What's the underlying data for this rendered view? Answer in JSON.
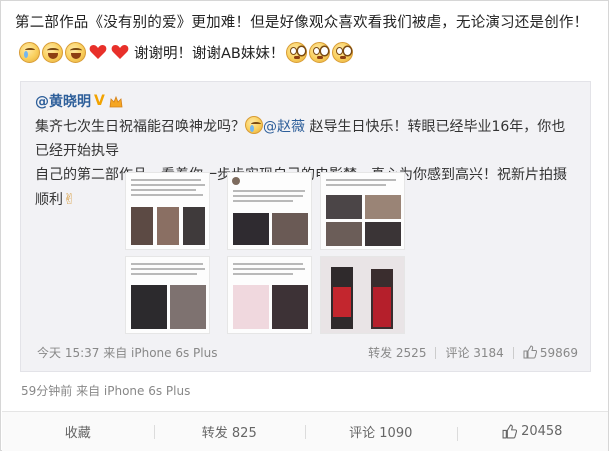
{
  "post": {
    "text_line1": "第二部作品《没有别的爱》更加难！但是好像观众喜欢看我们被虐，无论演习还是创作！",
    "text_line2": "谢谢明！谢谢AB妹妹！",
    "meta": "59分钟前 来自 iPhone 6s Plus",
    "emoji_left": [
      "tear-face",
      "laugh-face",
      "laugh-face",
      "red-heart",
      "red-heart"
    ],
    "emoji_right": [
      "wide-eyed-face",
      "wide-eyed-face",
      "wide-eyed-face"
    ]
  },
  "repost": {
    "author": "@黄晓明",
    "verified_badge": "V",
    "text_a": "集齐七次生日祝福能召唤神龙吗？",
    "mention": "@赵薇",
    "text_b": "赵导生日快乐！转眼已经毕业16年，你也已经开始执导",
    "text_c": "自己的第二部作品，看着你一步步实现自己的电影梦，真心为你感到高兴！祝新片拍摄顺利",
    "victory": "✌",
    "meta": "今天 15:37 来自 iPhone 6s Plus",
    "reposts": "转发 2525",
    "comments": "评论 3184",
    "likes": "59869"
  },
  "actions": {
    "favorite": "收藏",
    "repost": "转发 825",
    "comment": "评论 1090",
    "like": "20458"
  },
  "colors": {
    "link": "#2e5f9a",
    "badge": "#f2a300",
    "muted": "#888888"
  }
}
